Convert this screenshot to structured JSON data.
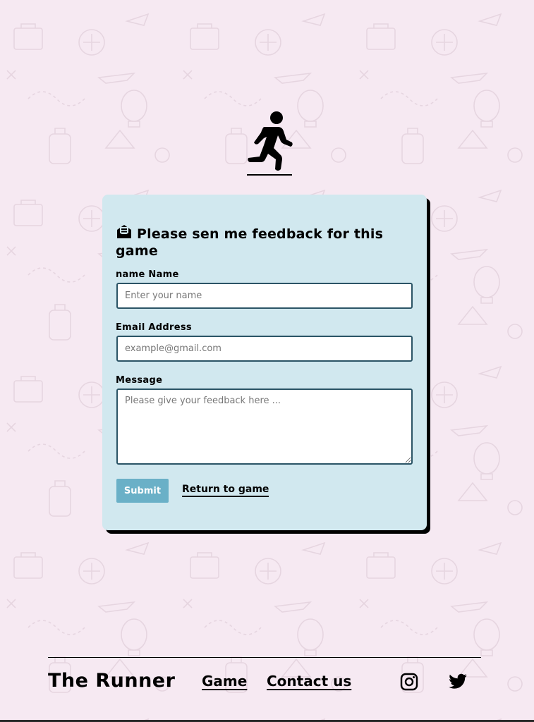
{
  "logo": {
    "icon": "running-person-icon"
  },
  "form": {
    "title": "Please sen me feedback for this game",
    "title_icon": "envelope-open-icon",
    "name_label": "name Name",
    "name_placeholder": "Enter your name",
    "email_label": "Email Address",
    "email_placeholder": "example@gmail.com",
    "message_label": "Message",
    "message_placeholder": "Please give your feedback here ...",
    "submit_label": "Submit",
    "return_label": "Return to game"
  },
  "footer": {
    "brand": "The Runner",
    "nav": [
      "Game",
      "Contact us"
    ],
    "social": [
      "instagram-icon",
      "twitter-icon"
    ]
  },
  "colors": {
    "background": "#f6e9f2",
    "card": "#d1e8ef",
    "input_border": "#2b5466",
    "button": "#6ab0c7"
  }
}
